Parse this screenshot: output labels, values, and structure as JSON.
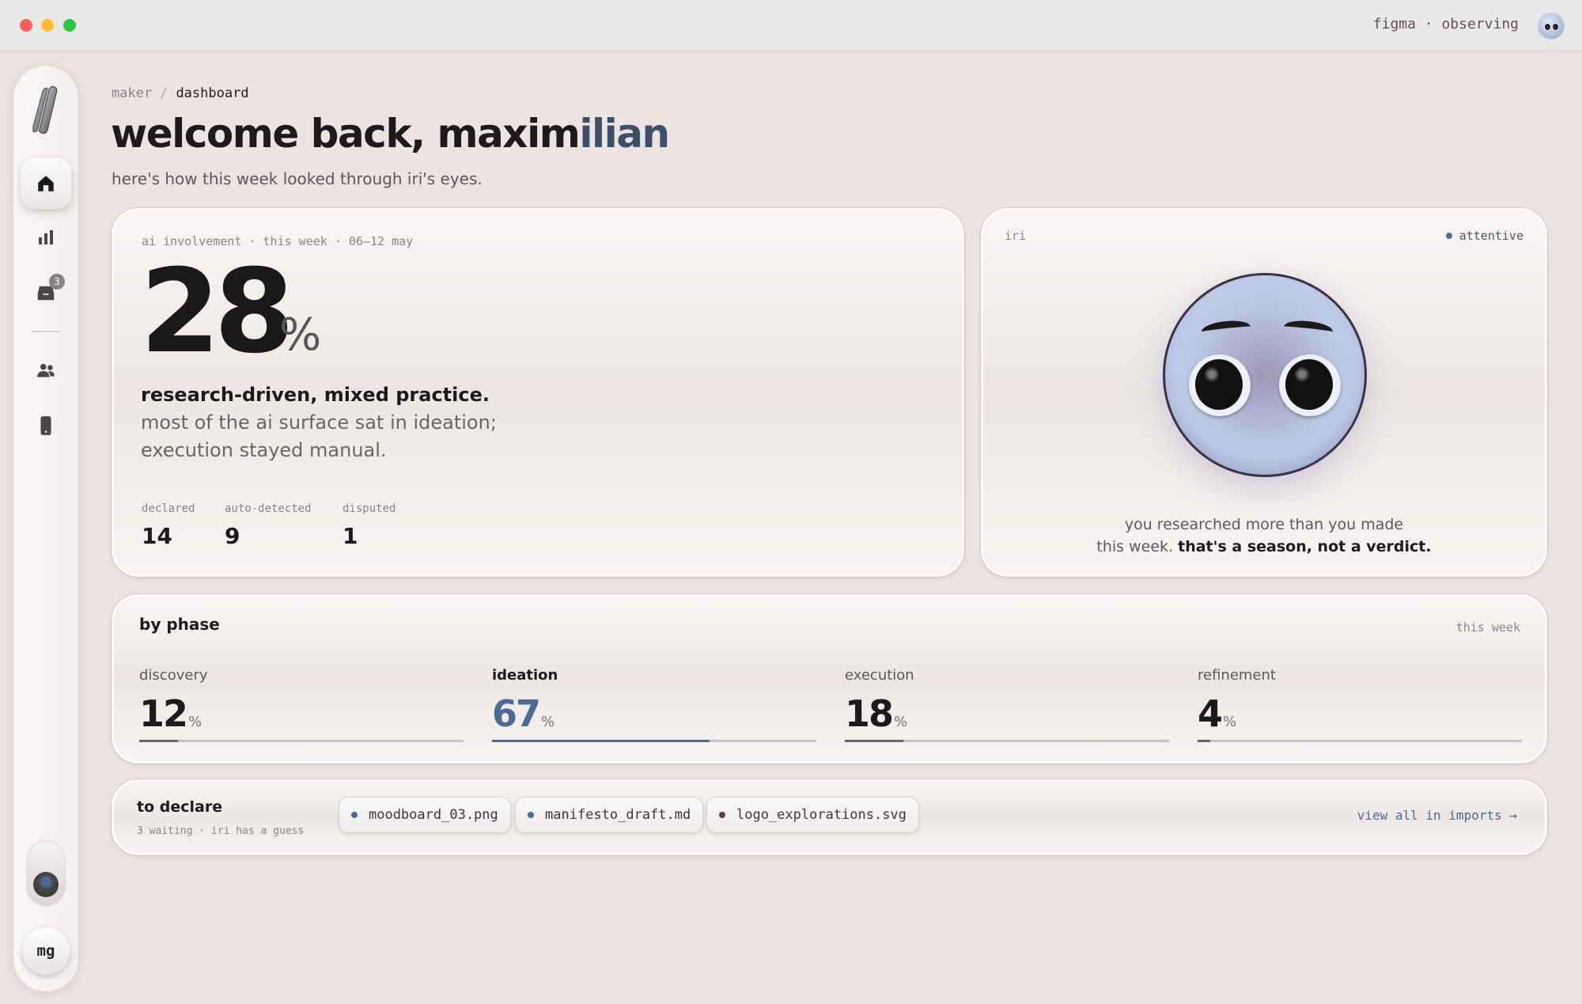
{
  "titlebar": {
    "status": "figma · observing"
  },
  "sidebar": {
    "inbox_badge": "3",
    "avatar_initials": "mg"
  },
  "breadcrumb": {
    "parent": "maker",
    "current": "dashboard"
  },
  "header": {
    "title_part1": "welcome back, maxim",
    "title_part2": "ilian",
    "subtitle": "here's how this week looked through iri's eyes."
  },
  "involvement": {
    "label": "ai involvement · this week · 06–12 may",
    "value": "28",
    "unit": "%",
    "headline": "research-driven, mixed practice.",
    "description": "most of the ai surface sat in ideation; execution stayed manual.",
    "stats": [
      {
        "label": "declared",
        "value": "14"
      },
      {
        "label": "auto-detected",
        "value": "9"
      },
      {
        "label": "disputed",
        "value": "1"
      }
    ]
  },
  "iri": {
    "name": "iri",
    "state": "attentive",
    "caption_line1": "you researched more than you made",
    "caption_line2_plain": "this week. ",
    "caption_line2_bold": "that's a season, not a verdict."
  },
  "phases": {
    "title": "by phase",
    "period": "this week",
    "items": [
      {
        "name": "discovery",
        "value": "12",
        "unit": "%",
        "fraction": 0.12,
        "color": "#6a6466",
        "text_color": "#1c1a1a"
      },
      {
        "name": "ideation",
        "value": "67",
        "unit": "%",
        "fraction": 0.67,
        "color": "#4e6a93",
        "text_color": "#4e6a93"
      },
      {
        "name": "execution",
        "value": "18",
        "unit": "%",
        "fraction": 0.18,
        "color": "#6a6466",
        "text_color": "#1c1a1a"
      },
      {
        "name": "refinement",
        "value": "4",
        "unit": "%",
        "fraction": 0.04,
        "color": "#6a6466",
        "text_color": "#1c1a1a"
      }
    ]
  },
  "declare": {
    "title": "to declare",
    "subtitle": "3 waiting · iri has a guess",
    "files": [
      {
        "name": "moodboard_03.png",
        "dot_color": "#4e6a93"
      },
      {
        "name": "manifesto_draft.md",
        "dot_color": "#4e6a93"
      },
      {
        "name": "logo_explorations.svg",
        "dot_color": "#5a3f4d"
      }
    ],
    "link": "view all in imports →"
  },
  "colors": {
    "accent": "#4e6a93",
    "background": "#ece3e2"
  }
}
